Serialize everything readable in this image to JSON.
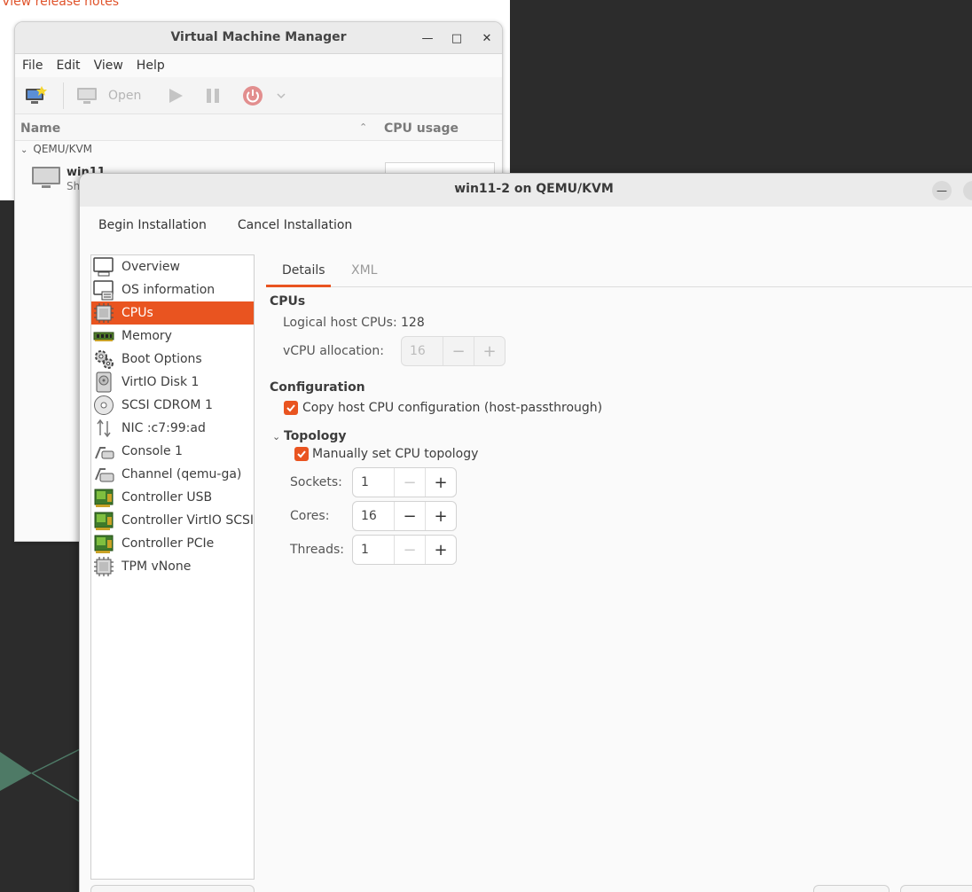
{
  "background": {
    "release_notes_link": "View release notes",
    "accent_color": "#e95420"
  },
  "vmm_window": {
    "title": "Virtual Machine Manager",
    "menu": [
      "File",
      "Edit",
      "View",
      "Help"
    ],
    "toolbar": {
      "open_label": "Open"
    },
    "list": {
      "col_name": "Name",
      "col_cpu": "CPU usage",
      "group": "QEMU/KVM",
      "vm_name": "win11",
      "vm_state": "Sh"
    }
  },
  "details_window": {
    "title": "win11-2 on QEMU/KVM",
    "menu": {
      "begin": "Begin Installation",
      "cancel": "Cancel Installation"
    },
    "hardware": [
      {
        "label": "Overview",
        "icon": "monitor-icon"
      },
      {
        "label": "OS information",
        "icon": "monitor-info-icon"
      },
      {
        "label": "CPUs",
        "icon": "cpu-chip-icon",
        "selected": true
      },
      {
        "label": "Memory",
        "icon": "memory-icon"
      },
      {
        "label": "Boot Options",
        "icon": "gears-icon"
      },
      {
        "label": "VirtIO Disk 1",
        "icon": "disk-icon"
      },
      {
        "label": "SCSI CDROM 1",
        "icon": "cdrom-icon"
      },
      {
        "label": "NIC :c7:99:ad",
        "icon": "network-icon"
      },
      {
        "label": "Console 1",
        "icon": "serial-icon"
      },
      {
        "label": "Channel (qemu-ga)",
        "icon": "channel-icon"
      },
      {
        "label": "Controller USB",
        "icon": "controller-icon"
      },
      {
        "label": "Controller VirtIO SCSI",
        "icon": "controller-icon"
      },
      {
        "label": "Controller PCIe",
        "icon": "controller-icon"
      },
      {
        "label": "TPM vNone",
        "icon": "tpm-chip-icon"
      }
    ],
    "tabs": {
      "details": "Details",
      "xml": "XML"
    },
    "cpus": {
      "section_title": "CPUs",
      "logical_label": "Logical host CPUs:",
      "logical_value": "128",
      "vcpu_label": "vCPU allocation:",
      "vcpu_value": "16"
    },
    "configuration": {
      "section_title": "Configuration",
      "copy_host_label": "Copy host CPU configuration (host-passthrough)",
      "copy_host_checked": true
    },
    "topology": {
      "section_title": "Topology",
      "manual_label": "Manually set CPU topology",
      "manual_checked": true,
      "sockets_label": "Sockets:",
      "sockets_value": "1",
      "cores_label": "Cores:",
      "cores_value": "16",
      "threads_label": "Threads:",
      "threads_value": "1"
    }
  }
}
